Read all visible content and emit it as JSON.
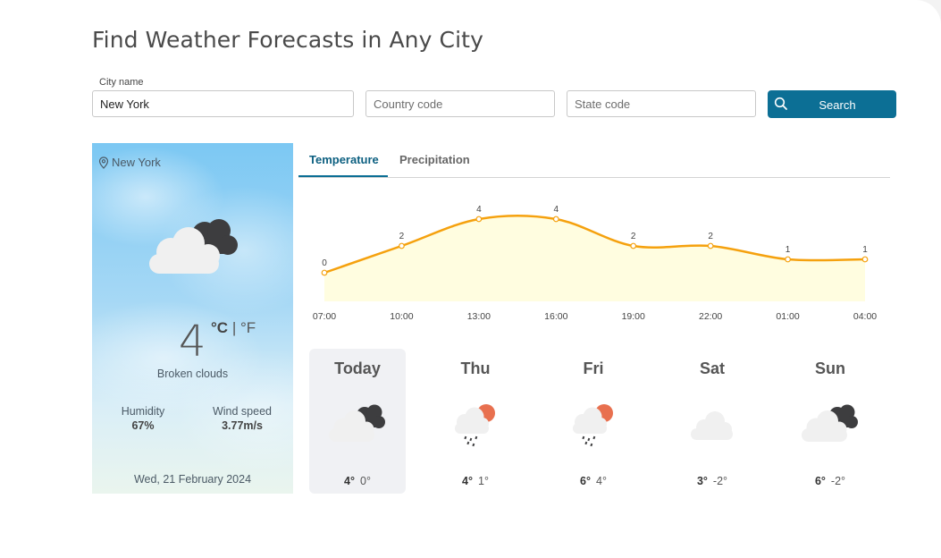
{
  "page": {
    "title": "Find Weather Forecasts in Any City"
  },
  "search": {
    "city_label": "City name",
    "city_value": "New York",
    "country_placeholder": "Country code",
    "state_placeholder": "State code",
    "button_label": "Search"
  },
  "current": {
    "location": "New York",
    "temperature": "4",
    "unit_c": "°C",
    "unit_sep": "|",
    "unit_f": "°F",
    "description": "Broken clouds",
    "humidity_label": "Humidity",
    "humidity_value": "67%",
    "wind_label": "Wind speed",
    "wind_value": "3.77m/s",
    "date": "Wed, 21 February 2024"
  },
  "tabs": [
    {
      "label": "Temperature",
      "active": true
    },
    {
      "label": "Precipitation",
      "active": false
    }
  ],
  "chart_data": {
    "type": "area",
    "categories": [
      "07:00",
      "10:00",
      "13:00",
      "16:00",
      "19:00",
      "22:00",
      "01:00",
      "04:00"
    ],
    "values": [
      0,
      2,
      4,
      4,
      2,
      2,
      1,
      1
    ],
    "line_color": "#f5a10e",
    "fill_color": "#fffde0"
  },
  "forecast": [
    {
      "day": "Today",
      "icon": "broken-clouds-icon",
      "high": "4°",
      "low": "0°",
      "active": true
    },
    {
      "day": "Thu",
      "icon": "rain-sun-icon",
      "high": "4°",
      "low": "1°",
      "active": false
    },
    {
      "day": "Fri",
      "icon": "rain-sun-icon",
      "high": "6°",
      "low": "4°",
      "active": false
    },
    {
      "day": "Sat",
      "icon": "cloud-icon",
      "high": "3°",
      "low": "-2°",
      "active": false
    },
    {
      "day": "Sun",
      "icon": "broken-clouds-icon",
      "high": "6°",
      "low": "-2°",
      "active": false
    }
  ]
}
